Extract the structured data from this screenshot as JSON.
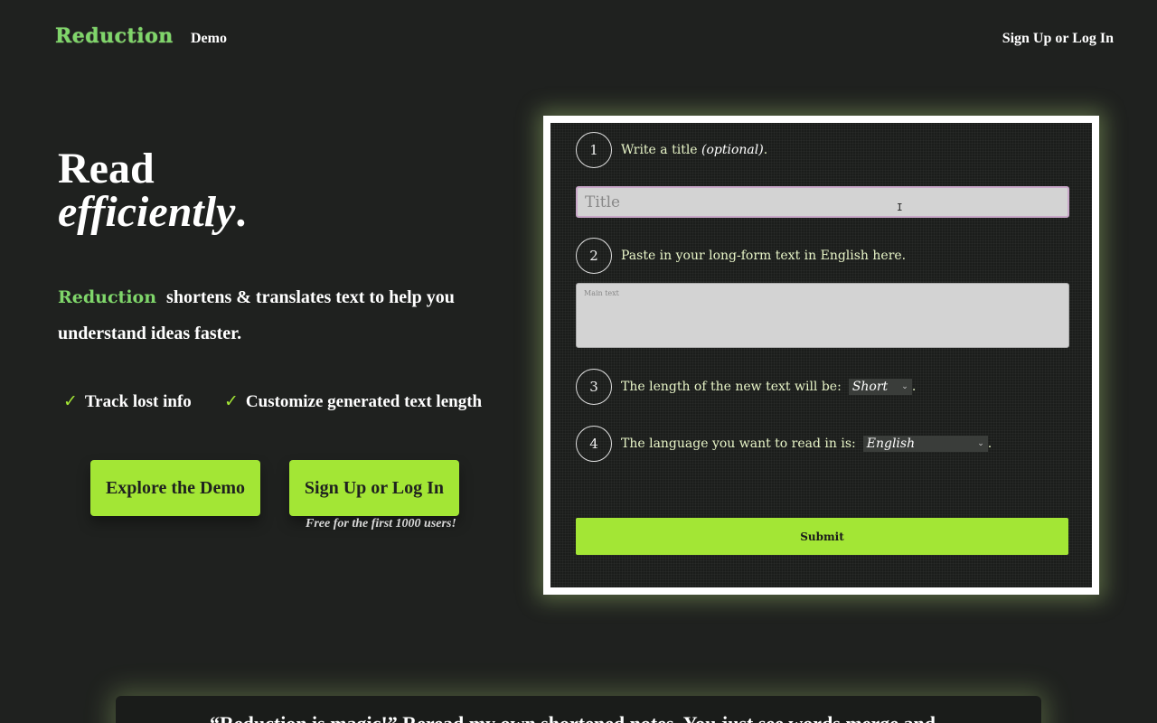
{
  "nav": {
    "logo": "Reduction",
    "demo_link": "Demo",
    "signup_link": "Sign Up or Log In"
  },
  "hero": {
    "title_line1": "Read",
    "title_line2": "efficiently",
    "title_period": ".",
    "brand": "Reduction",
    "tagline": "shortens & translates text to help you understand ideas faster.",
    "features": [
      {
        "check": "✓",
        "label": "Track lost info"
      },
      {
        "check": "✓",
        "label": "Customize generated text length"
      }
    ],
    "demo_button": "Explore the Demo",
    "signup_button": "Sign Up or Log In",
    "free_note": "Free for the first 1000 users!"
  },
  "demo": {
    "steps": [
      {
        "num": "1",
        "text": "Write a title ",
        "em": "(optional)",
        "suffix": "."
      },
      {
        "num": "2",
        "text": "Paste in your long-form text in English here."
      },
      {
        "num": "3",
        "text": "The length of the new text will be:",
        "suffix": "."
      },
      {
        "num": "4",
        "text": "The language you want to read in is:",
        "suffix": "."
      }
    ],
    "title_placeholder": "Title",
    "text_placeholder": "Main text",
    "length_value": "Short",
    "language_value": "English",
    "submit_label": "Submit"
  },
  "banner": {
    "text": "“Reduction is magic!” Reread my own shortened notes. You just see words merge and ..."
  }
}
